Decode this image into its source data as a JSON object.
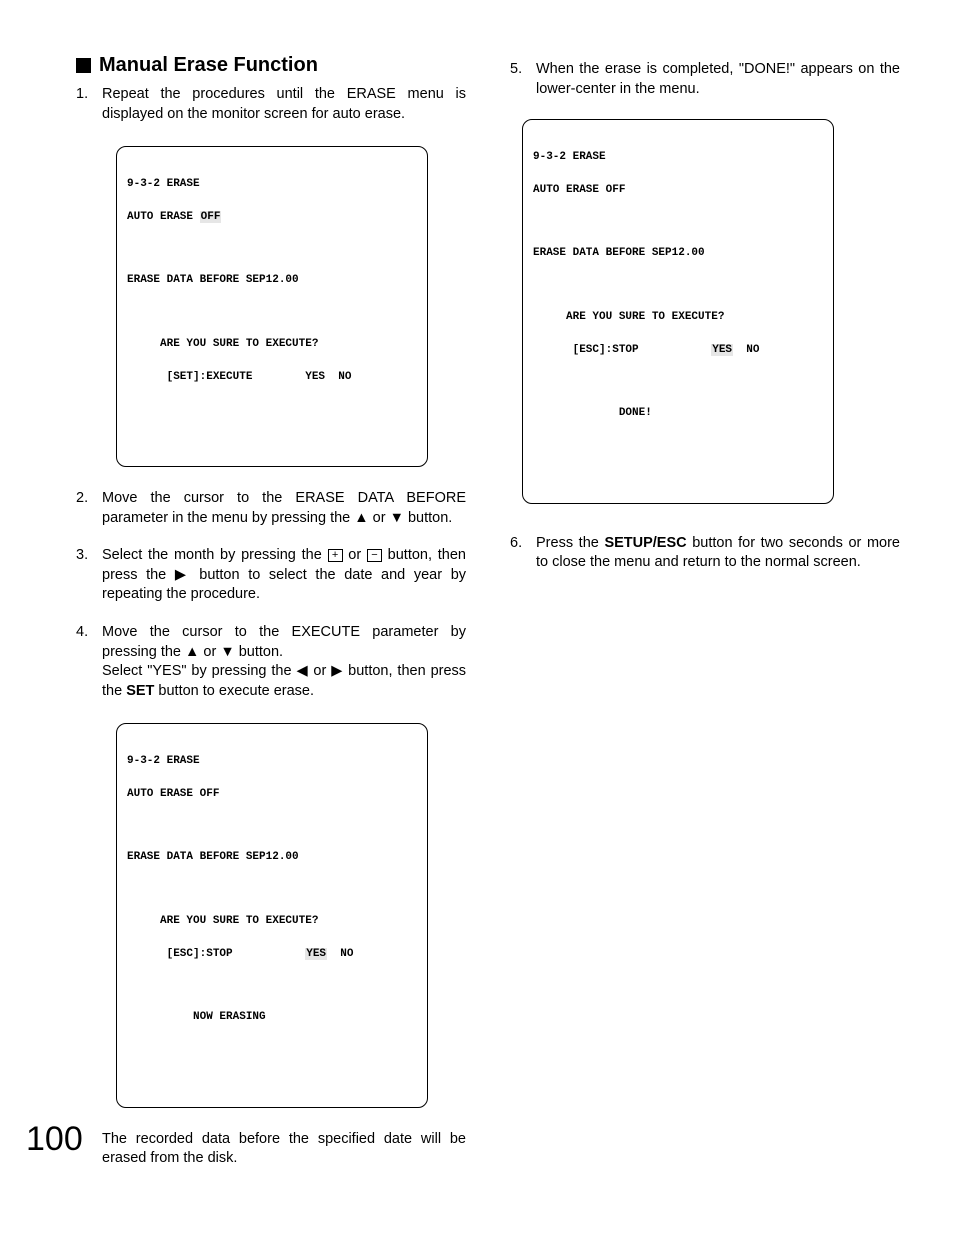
{
  "section_title": "Manual Erase Function",
  "left": {
    "step1": {
      "num": "1.",
      "text_a": "Repeat the procedures until the ERASE menu is displayed on the monitor screen for auto erase."
    },
    "screen1": {
      "l1": "9-3-2 ERASE",
      "l2a": "AUTO ERASE ",
      "l2b": "OFF",
      "l3": "ERASE DATA BEFORE SEP12.00",
      "l4": "     ARE YOU SURE TO EXECUTE?",
      "l5": "      [SET]:EXECUTE        YES  NO"
    },
    "step2": {
      "num": "2.",
      "text_a": "Move the cursor to the ERASE DATA BEFORE parameter in the menu by pressing the ",
      "up": "▲",
      "mid": " or ",
      "down": "▼",
      "text_b": " button."
    },
    "step3": {
      "num": "3.",
      "text_a": "Select the month by pressing the ",
      "plus": "+",
      "mid1": " or ",
      "minus": "−",
      "text_b": " button, then press the ",
      "right": "▶",
      "text_c": " button to select the date and year by repeating the procedure."
    },
    "step4": {
      "num": "4.",
      "text_a": "Move the cursor to the EXECUTE parameter by pressing the ",
      "up": "▲",
      "mid1": " or ",
      "down": "▼",
      "text_b": " button.",
      "text_c": "Select \"YES\" by pressing the ",
      "left": "◀",
      "mid2": " or ",
      "right": "▶",
      "text_d": " button, then press the ",
      "set": "SET",
      "text_e": " button to execute erase."
    },
    "screen2": {
      "l1": "9-3-2 ERASE",
      "l2": "AUTO ERASE OFF",
      "l3": "ERASE DATA BEFORE SEP12.00",
      "l4": "     ARE YOU SURE TO EXECUTE?",
      "l5a": "      [ESC]:STOP           ",
      "l5yes": "YES",
      "l5b": "  NO",
      "l6": "          NOW ERASING"
    },
    "step4_after": "The recorded data before the specified date will be erased from the disk."
  },
  "right": {
    "step5": {
      "num": "5.",
      "text_a": "When the erase is completed, \"DONE!\" appears on the lower-center in the menu."
    },
    "screen3": {
      "l1": "9-3-2 ERASE",
      "l2": "AUTO ERASE OFF",
      "l3": "ERASE DATA BEFORE SEP12.00",
      "l4": "     ARE YOU SURE TO EXECUTE?",
      "l5a": "      [ESC]:STOP           ",
      "l5yes": "YES",
      "l5b": "  NO",
      "l6": "             DONE!"
    },
    "step6": {
      "num": "6.",
      "text_a": "Press the ",
      "setup": "SETUP/ESC",
      "text_b": " button for two seconds or more to close the menu and return to the normal screen."
    }
  },
  "page_number": "100"
}
